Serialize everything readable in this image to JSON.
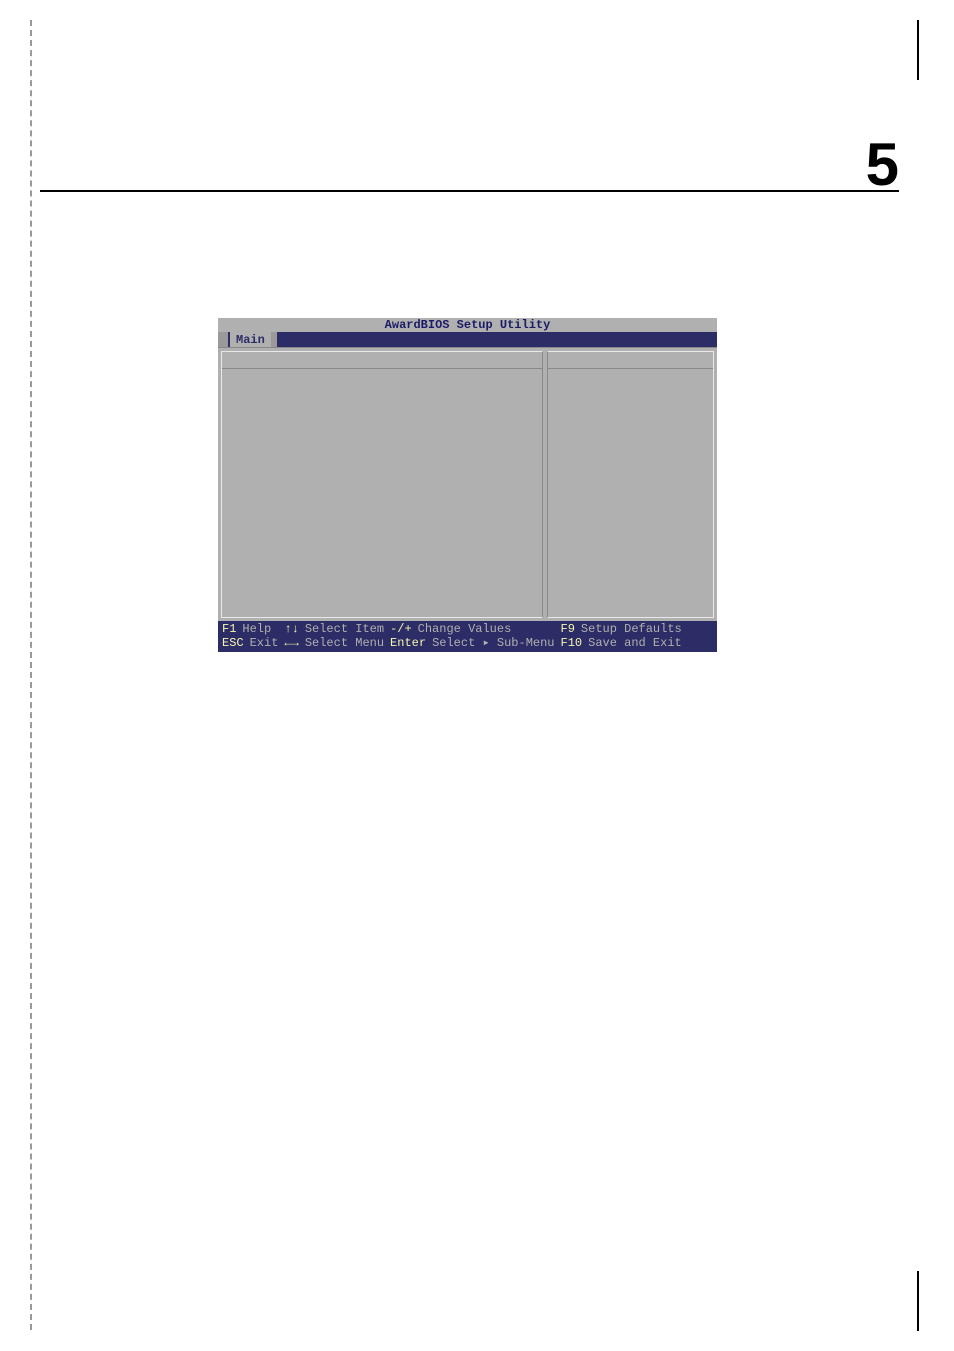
{
  "page": {
    "number": "5"
  },
  "bios": {
    "title": "AwardBIOS Setup Utility",
    "tab": "Main",
    "footer": {
      "col1": {
        "key1": "F1",
        "label1": "Help",
        "key2": "ESC",
        "label2": "Exit"
      },
      "col2": {
        "key1": "↑↓",
        "label1": "Select Item",
        "key2": "←→",
        "label2": "Select Menu"
      },
      "col3": {
        "key1": "-/+",
        "label1": "Change Values",
        "key2": "Enter",
        "label2": "Select ▸ Sub-Menu"
      },
      "col4": {
        "key1": "F9",
        "label1": "Setup Defaults",
        "key2": "F10",
        "label2": "Save and Exit"
      }
    }
  }
}
